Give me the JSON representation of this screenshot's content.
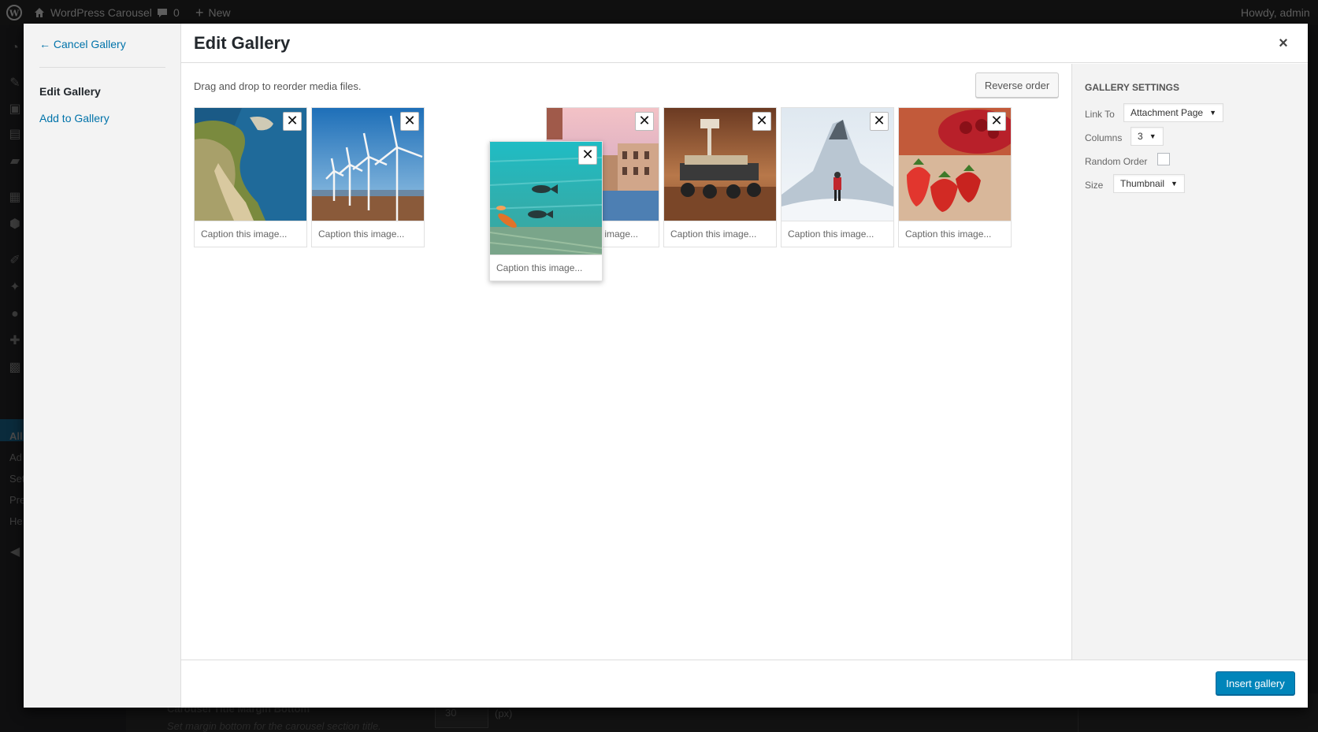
{
  "admin_bar": {
    "site_name": "WordPress Carousel",
    "comments_count": "0",
    "new_label": "New",
    "howdy": "Howdy, admin"
  },
  "wp_sidebar": {
    "submenu": [
      "All",
      "Ad",
      "Set",
      "Pre",
      "He"
    ]
  },
  "background_form": {
    "field_label": "Carousel Title Margin Bottom",
    "field_description": "Set margin bottom for the carousel section title.",
    "field_value": "30",
    "field_unit": "(px)"
  },
  "menu": {
    "cancel": "← Cancel Gallery",
    "items": [
      {
        "label": "Edit Gallery",
        "active": true
      },
      {
        "label": "Add to Gallery",
        "active": false
      }
    ]
  },
  "title": "Edit Gallery",
  "close_icon": "×",
  "content": {
    "instructions": "Drag and drop to reorder media files.",
    "reverse_order": "Reverse order"
  },
  "gallery": {
    "caption_placeholder": "Caption this image...",
    "remove_symbol": "✕",
    "items": [
      {
        "caption": "Caption this image...",
        "subject": "coastal cliffs and beach"
      },
      {
        "caption": "Caption this image...",
        "subject": "wind turbines"
      },
      {
        "caption": "s image...",
        "subject": "venice canal"
      },
      {
        "caption": "Caption this image...",
        "subject": "mars rover"
      },
      {
        "caption": "Caption this image...",
        "subject": "snowy mountain"
      },
      {
        "caption": "Caption this image...",
        "subject": "strawberries"
      }
    ],
    "dragging_item": {
      "caption": "Caption this image...",
      "subject": "fish swimming"
    }
  },
  "settings": {
    "heading": "Gallery Settings",
    "link_to": {
      "label": "Link To",
      "value": "Attachment Page"
    },
    "columns": {
      "label": "Columns",
      "value": "3"
    },
    "random_order": {
      "label": "Random Order",
      "checked": false
    },
    "size": {
      "label": "Size",
      "value": "Thumbnail"
    }
  },
  "toolbar": {
    "insert": "Insert gallery"
  },
  "colors": {
    "accent": "#0085ba",
    "link": "#0073aa"
  }
}
